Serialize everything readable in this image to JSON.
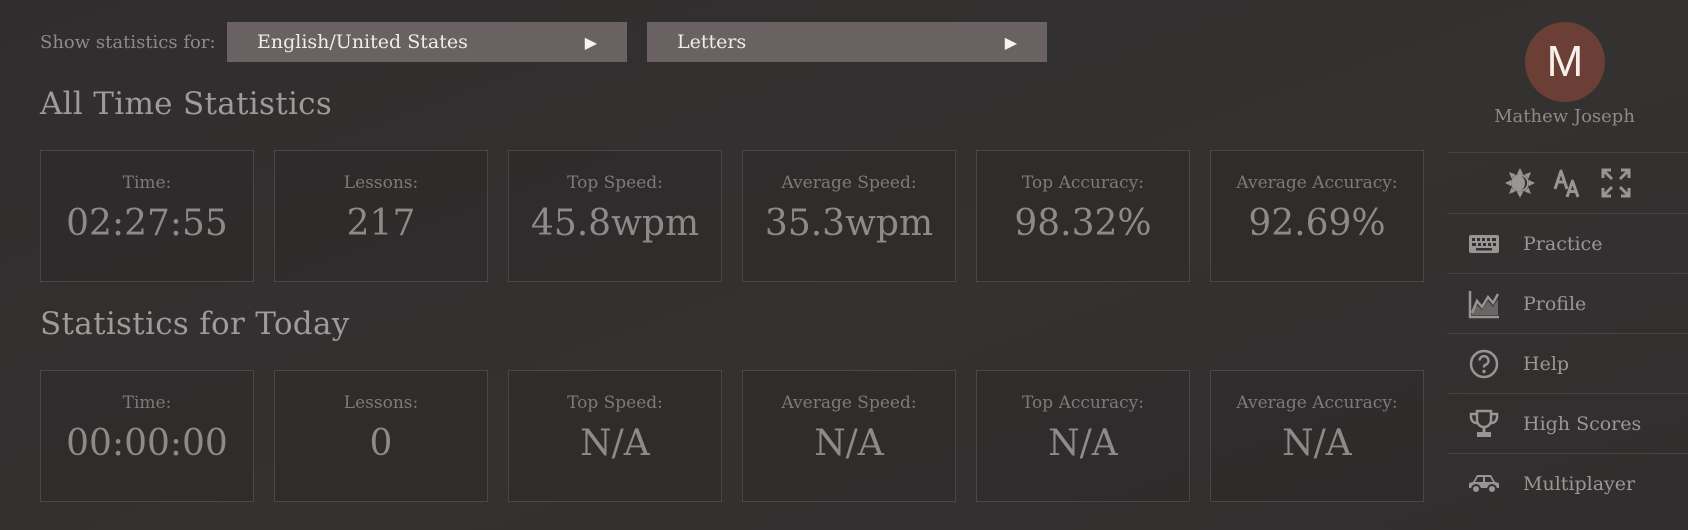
{
  "filters": {
    "label": "Show statistics for:",
    "language": "English/United States",
    "mode": "Letters",
    "arrow_glyph": "▶"
  },
  "all_time": {
    "title": "All Time Statistics",
    "stats": [
      {
        "label": "Time:",
        "value": "02:27:55"
      },
      {
        "label": "Lessons:",
        "value": "217"
      },
      {
        "label": "Top Speed:",
        "value": "45.8wpm"
      },
      {
        "label": "Average Speed:",
        "value": "35.3wpm"
      },
      {
        "label": "Top Accuracy:",
        "value": "98.32%"
      },
      {
        "label": "Average Accuracy:",
        "value": "92.69%"
      }
    ]
  },
  "today": {
    "title": "Statistics for Today",
    "stats": [
      {
        "label": "Time:",
        "value": "00:00:00"
      },
      {
        "label": "Lessons:",
        "value": "0"
      },
      {
        "label": "Top Speed:",
        "value": "N/A"
      },
      {
        "label": "Average Speed:",
        "value": "N/A"
      },
      {
        "label": "Top Accuracy:",
        "value": "N/A"
      },
      {
        "label": "Average Accuracy:",
        "value": "N/A"
      }
    ]
  },
  "user": {
    "initial": "M",
    "name": "Mathew Joseph",
    "avatar_color": "#6b3f36"
  },
  "tools": [
    {
      "icon": "brightness-icon"
    },
    {
      "icon": "font-size-icon"
    },
    {
      "icon": "fullscreen-icon"
    }
  ],
  "nav": [
    {
      "label": "Practice",
      "icon": "keyboard-icon"
    },
    {
      "label": "Profile",
      "icon": "chart-icon"
    },
    {
      "label": "Help",
      "icon": "help-icon"
    },
    {
      "label": "High Scores",
      "icon": "trophy-icon"
    },
    {
      "label": "Multiplayer",
      "icon": "car-icon"
    }
  ],
  "colors": {
    "background": "#312f2f",
    "select_bg": "#6a6262",
    "text": "#8f8a8a",
    "icon": "#9a9494"
  }
}
